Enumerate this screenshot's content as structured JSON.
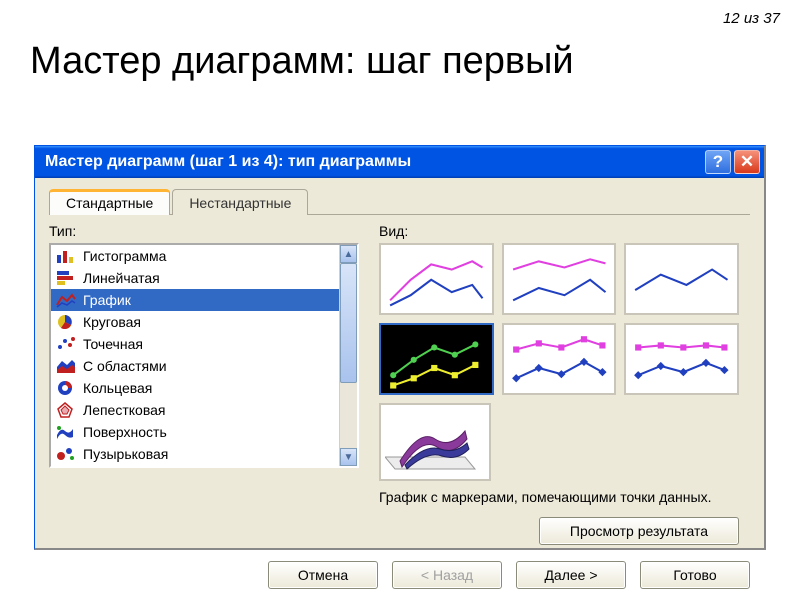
{
  "slide": {
    "page_indicator": "12 из 37",
    "title": "Мастер диаграмм: шаг первый"
  },
  "dialog": {
    "title": "Мастер диаграмм (шаг 1 из 4): тип диаграммы",
    "help_label": "?",
    "close_symbol": "✕",
    "tabs": {
      "standard": "Стандартные",
      "custom": "Нестандартные"
    },
    "type_label": "Тип:",
    "view_label": "Вид:",
    "types": [
      {
        "icon": "histogram",
        "label": "Гистограмма"
      },
      {
        "icon": "bar",
        "label": "Линейчатая"
      },
      {
        "icon": "line",
        "label": "График"
      },
      {
        "icon": "pie",
        "label": "Круговая"
      },
      {
        "icon": "scatter",
        "label": "Точечная"
      },
      {
        "icon": "area",
        "label": "С областями"
      },
      {
        "icon": "donut",
        "label": "Кольцевая"
      },
      {
        "icon": "radar",
        "label": "Лепестковая"
      },
      {
        "icon": "surface",
        "label": "Поверхность"
      },
      {
        "icon": "bubble",
        "label": "Пузырьковая"
      }
    ],
    "selected_type_index": 2,
    "selected_subtype_index": 3,
    "subtype_description": "График с маркерами, помечающими точки данных.",
    "preview_button": "Просмотр результата",
    "buttons": {
      "cancel": "Отмена",
      "back": "< Назад",
      "next": "Далее >",
      "finish": "Готово"
    }
  }
}
